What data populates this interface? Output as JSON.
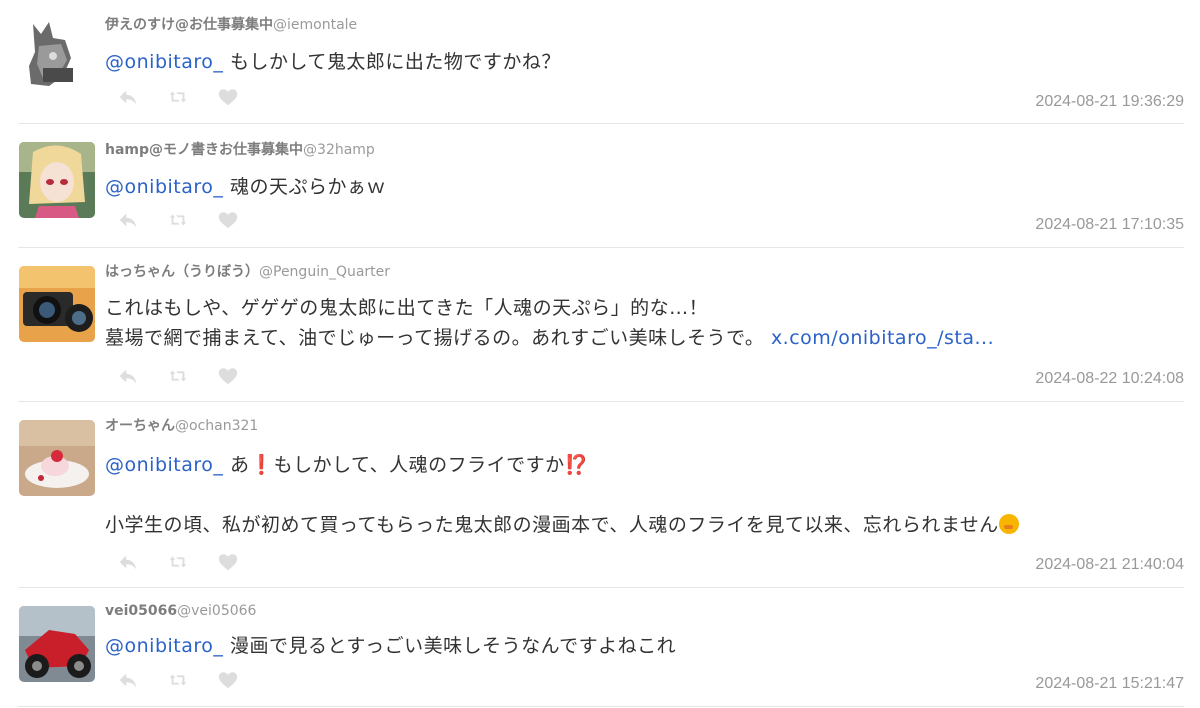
{
  "tweets": [
    {
      "name": "伊えのすけ",
      "badge": "@お仕事募集中",
      "handle": "@iemontale",
      "mention": "@onibitaro_",
      "text": " もしかして鬼太郎に出た物ですかね？",
      "time": "2024-08-21 19:36:29"
    },
    {
      "name": "hamp",
      "badge": "@モノ書きお仕事募集中",
      "handle": "@32hamp",
      "mention": "@onibitaro_",
      "text": " 魂の天ぷらかぁｗ",
      "time": "2024-08-21 17:10:35"
    },
    {
      "name": "はっちゃん（うりぼう）",
      "badge": "",
      "handle": "@Penguin_Quarter",
      "line1": "これはもしや、ゲゲゲの鬼太郎に出てきた「人魂の天ぷら」的な…！",
      "line2": "墓場で網で捕まえて、油でじゅーって揚げるの。あれすごい美味しそうで。 ",
      "link": "x.com/onibitaro_/sta...",
      "time": "2024-08-22 10:24:08"
    },
    {
      "name": "オーちゃん",
      "badge": "",
      "handle": "@ochan321",
      "mention": "@onibitaro_",
      "text_a": " あ",
      "exclaim": "❗",
      "text_b": "もしかして、人魂のフライですか",
      "interrobang": "⁉️",
      "line2": "小学生の頃、私が初めて買ってもらった鬼太郎の漫画本で、人魂のフライを見て以来、忘れられません",
      "time": "2024-08-21 21:40:04"
    },
    {
      "name": "vei05066",
      "badge": "",
      "handle": "@vei05066",
      "mention": "@onibitaro_",
      "text": " 漫画で見るとすっごい美味しそうなんですよねこれ",
      "time": "2024-08-21 15:21:47"
    }
  ],
  "icons": [
    "reply-icon",
    "retweet-icon",
    "like-icon"
  ],
  "colors": {
    "mention": "#2b62c8",
    "meta": "#999999",
    "icon": "#dddddd",
    "divider": "#e6e6e6"
  }
}
